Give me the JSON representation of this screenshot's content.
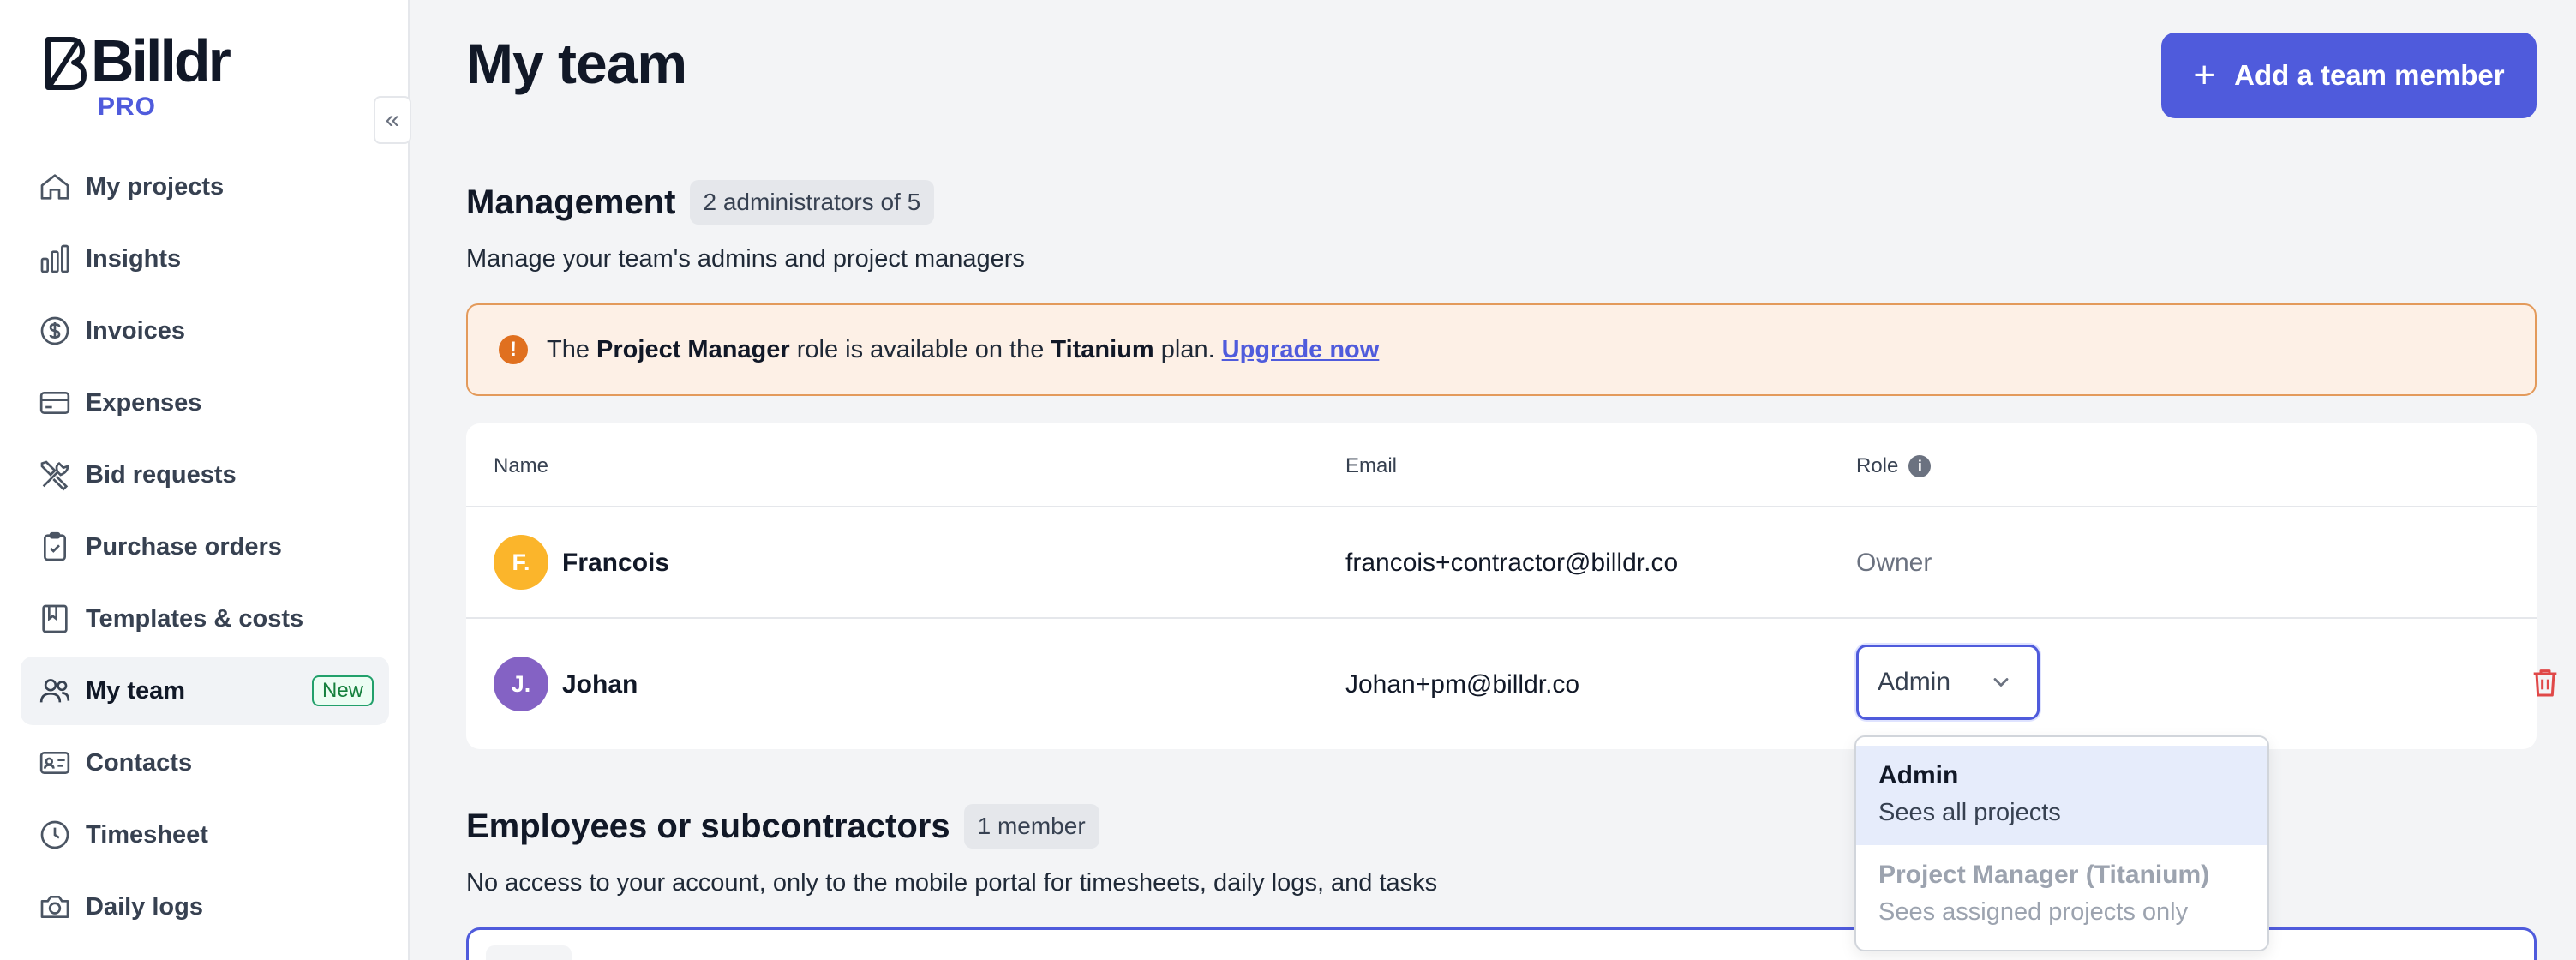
{
  "brand": {
    "name": "Billdr",
    "tier": "PRO"
  },
  "sidebar": {
    "collapse_label": "«",
    "items": [
      {
        "label": "My projects",
        "icon": "home-icon"
      },
      {
        "label": "Insights",
        "icon": "chart-icon"
      },
      {
        "label": "Invoices",
        "icon": "dollar-icon"
      },
      {
        "label": "Expenses",
        "icon": "card-icon"
      },
      {
        "label": "Bid requests",
        "icon": "tools-icon"
      },
      {
        "label": "Purchase orders",
        "icon": "clipboard-icon"
      },
      {
        "label": "Templates & costs",
        "icon": "book-icon"
      },
      {
        "label": "My team",
        "icon": "users-icon",
        "badge": "New",
        "active": true
      },
      {
        "label": "Contacts",
        "icon": "contact-card-icon"
      },
      {
        "label": "Timesheet",
        "icon": "clock-icon"
      },
      {
        "label": "Daily logs",
        "icon": "camera-icon"
      }
    ]
  },
  "header": {
    "title": "My team",
    "add_button": "Add a team member"
  },
  "management": {
    "title": "Management",
    "count": "2 administrators of 5",
    "description": "Manage your team's admins and project managers",
    "alert": {
      "prefix": "The",
      "role": "Project Manager",
      "middle": "role is available on the",
      "plan": "Titanium",
      "suffix": "plan.",
      "link": "Upgrade now"
    },
    "table": {
      "columns": {
        "name": "Name",
        "email": "Email",
        "role": "Role"
      },
      "rows": [
        {
          "initials": "F.",
          "name": "Francois",
          "email": "francois+contractor@billdr.co",
          "role": "Owner",
          "avatar_color": "#fbb52b"
        },
        {
          "initials": "J.",
          "name": "Johan",
          "email": "Johan+pm@billdr.co",
          "role": "Admin",
          "avatar_color": "#8462c4"
        }
      ]
    },
    "role_options": [
      {
        "title": "Admin",
        "subtitle": "Sees all projects",
        "selected": true
      },
      {
        "title": "Project Manager (Titanium)",
        "subtitle": "Sees assigned projects only",
        "disabled": true
      }
    ]
  },
  "employees": {
    "title": "Employees or subcontractors",
    "count": "1 member",
    "description": "No access to your account, only to the mobile portal for timesheets, daily logs, and tasks"
  },
  "colors": {
    "accent": "#4f5bdc",
    "alert_bg": "#fdf0e6",
    "alert_border": "#e39a5b",
    "danger": "#e04848"
  }
}
